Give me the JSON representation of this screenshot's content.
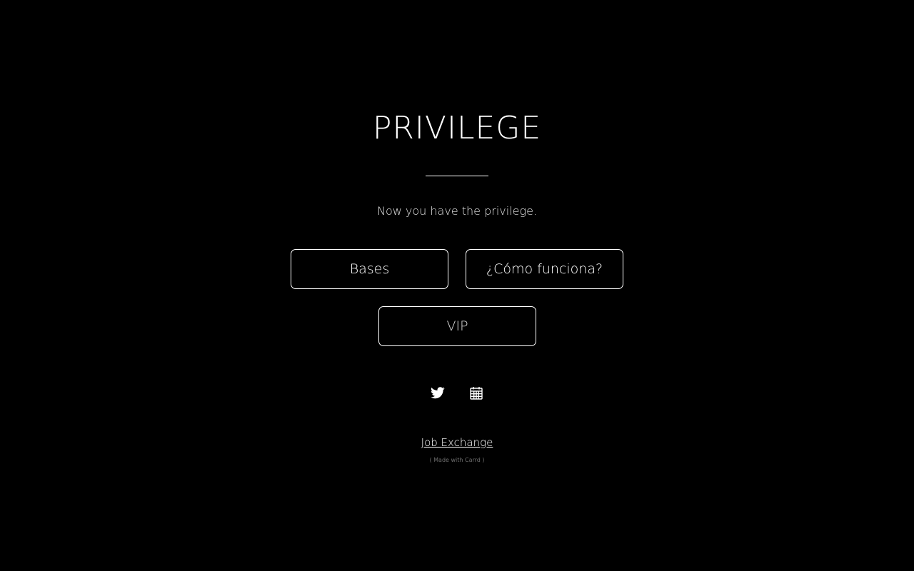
{
  "page": {
    "title": "PRIVILEGE",
    "subtitle": "Now you have the privilege."
  },
  "buttons": {
    "bases": "Bases",
    "como_funciona": "¿Cómo funciona?",
    "vip": "VIP"
  },
  "social": {
    "icons": [
      "twitter-icon",
      "calendar-icon"
    ]
  },
  "footer": {
    "link_text": "Job Exchange",
    "credit": "( Made with Carrd )"
  },
  "colors": {
    "background": "#000000",
    "foreground": "#ffffff",
    "muted": "#6f6f6f"
  }
}
